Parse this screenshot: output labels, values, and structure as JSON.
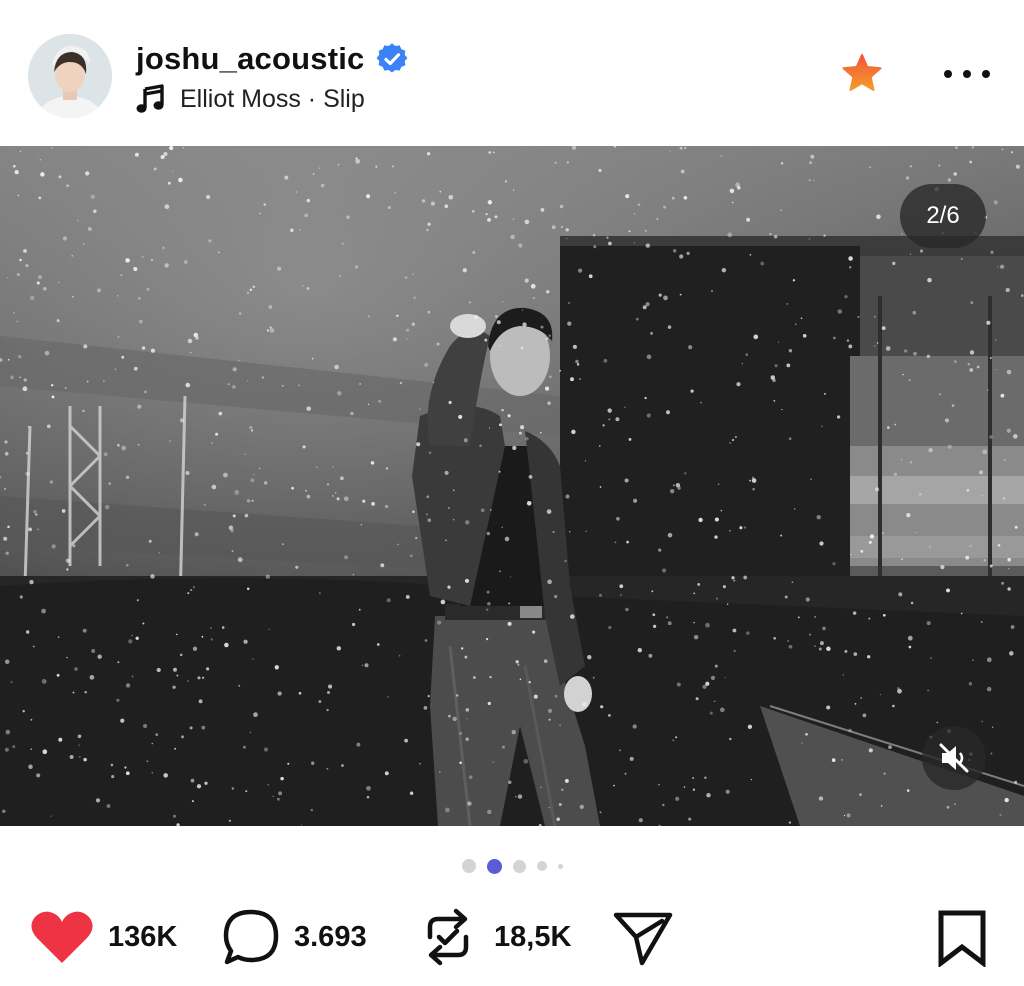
{
  "post": {
    "username": "joshu_acoustic",
    "verified": true,
    "music": {
      "artist": "Elliot Moss",
      "separator": "·",
      "track": "Slip",
      "label": "Elliot Moss · Slip"
    },
    "icons": {
      "avatar": "avatar",
      "verified": "verified-badge-icon",
      "music": "music-note-icon",
      "favorite": "star-icon",
      "more": "more-options-icon"
    }
  },
  "media": {
    "counter": "2/6",
    "muted": true,
    "pagination": {
      "total_visible": 5,
      "active_index": 1
    }
  },
  "actions": {
    "likes": "136K",
    "comments": "3.693",
    "reposts": "18,5K",
    "icons": [
      "heart-icon",
      "comment-icon",
      "repost-icon",
      "send-icon",
      "bookmark-icon"
    ]
  },
  "colors": {
    "verified_blue": "#3b82f6",
    "star_orange": "#f26a2e",
    "like_red": "#ee3344",
    "active_dot": "#5b5bd6"
  }
}
